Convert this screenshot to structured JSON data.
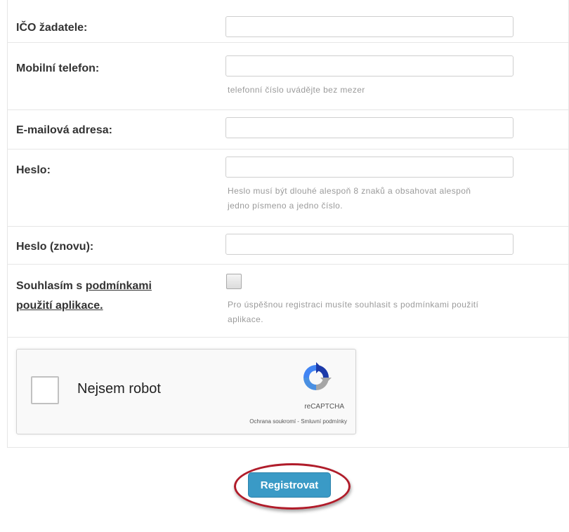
{
  "fields": {
    "ico": {
      "label": "IČO žadatele:",
      "value": ""
    },
    "phone": {
      "label": "Mobilní telefon:",
      "value": "",
      "help": "telefonní číslo uvádějte bez mezer"
    },
    "email": {
      "label": "E-mailová adresa:",
      "value": ""
    },
    "password": {
      "label": "Heslo:",
      "value": "",
      "help_line1": "Heslo musí být dlouhé alespoň 8 znaků a obsahovat alespoň",
      "help_line2": "jedno písmeno a jedno číslo."
    },
    "password_again": {
      "label": "Heslo (znovu):",
      "value": ""
    }
  },
  "terms": {
    "label_prefix": "Souhlasím s ",
    "link_line1": "podmínkami",
    "link_line2": "použití aplikace.",
    "checked": false,
    "help_line1": "Pro úspěšnou registraci musíte souhlasit s podmínkami použití",
    "help_line2": "aplikace."
  },
  "captcha": {
    "label": "Nejsem robot",
    "brand": "reCAPTCHA",
    "links": "Ochrana soukromí - Smluvní podmínky",
    "checked": false
  },
  "submit": {
    "label": "Registrovat"
  },
  "colors": {
    "button": "#3a9ac6",
    "highlight": "#b01c2a"
  }
}
